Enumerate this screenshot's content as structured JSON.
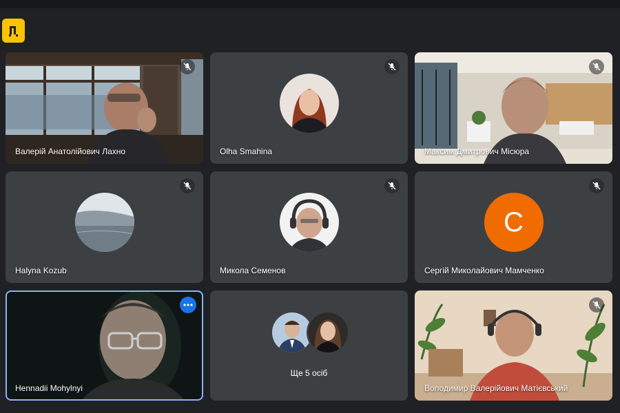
{
  "app": {
    "logo_text": "Д"
  },
  "participants": [
    {
      "name": "Валерій Анатолійович Лахно",
      "muted": true,
      "video": true
    },
    {
      "name": "Olha Smahina",
      "muted": true,
      "video": false
    },
    {
      "name": "Максим Дмитрович Місюра",
      "muted": true,
      "video": true
    },
    {
      "name": "Halyna Kozub",
      "muted": true,
      "video": false
    },
    {
      "name": "Микола Семенов",
      "muted": true,
      "video": false
    },
    {
      "name": "Сергій Миколайович Мамченко",
      "muted": true,
      "video": false,
      "avatar_letter": "С",
      "avatar_color": "#f06c00"
    },
    {
      "name": "Hennadii Mohylnyi",
      "muted": false,
      "video": true,
      "speaking": true
    },
    {
      "name": "Володимир Валерійович Матієвський",
      "muted": true,
      "video": true
    }
  ],
  "others_tile": {
    "label": "Ще 5 осіб"
  },
  "colors": {
    "background": "#202124",
    "tile": "#3c4043",
    "accent": "#8ab4f8",
    "more_button": "#1a73e8",
    "logo": "#f9c300"
  },
  "icons": {
    "mute": "mic-off-icon",
    "more": "more-options-icon"
  }
}
